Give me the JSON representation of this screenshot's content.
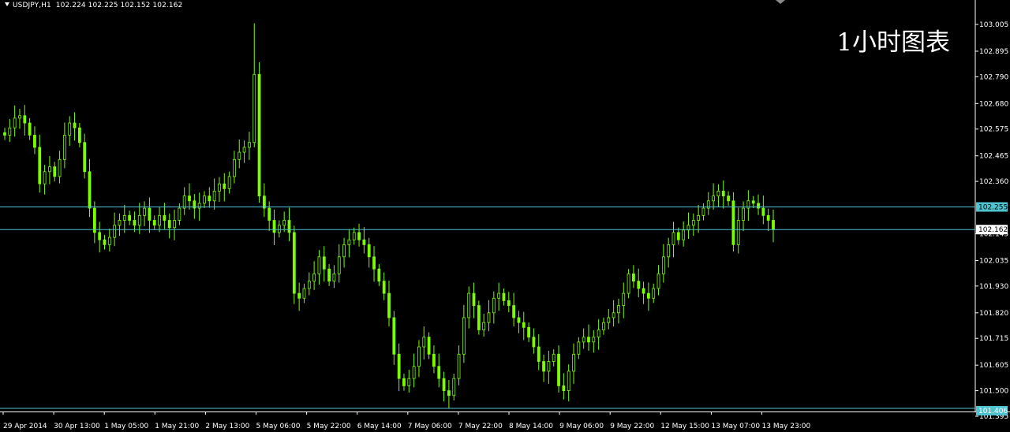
{
  "header": {
    "symbol": "USDJPY,H1",
    "prices": "102.224 102.225 102.152 102.162"
  },
  "watermark": "1小时图表",
  "colors": {
    "background": "#000000",
    "candle": "#7CFC00",
    "axis": "#ffffff",
    "hline": "#4fc3d0",
    "bid_tag_bg": "#ffffff",
    "hline_tag_bg": "#4fc3d0"
  },
  "chart_data": {
    "type": "candlestick",
    "title": "USDJPY,H1",
    "ylim": [
      101.395,
      103.11
    ],
    "y_ticks": [
      "103.005",
      "102.895",
      "102.790",
      "102.680",
      "102.575",
      "102.465",
      "102.360",
      "102.145",
      "102.035",
      "101.930",
      "101.820",
      "101.715",
      "101.605",
      "101.500",
      "101.395"
    ],
    "x_ticks": [
      "29 Apr 2014",
      "30 Apr 13:00",
      "1 May 05:00",
      "1 May 21:00",
      "2 May 13:00",
      "5 May 06:00",
      "5 May 22:00",
      "6 May 14:00",
      "7 May 06:00",
      "7 May 22:00",
      "8 May 14:00",
      "9 May 06:00",
      "9 May 22:00",
      "12 May 15:00",
      "13 May 07:00",
      "13 May 23:00"
    ],
    "hlines": [
      {
        "label": "102.255",
        "value": 102.255
      },
      {
        "label": "102.162",
        "value": 102.162
      }
    ],
    "bottom_tag": {
      "label": "101.406",
      "value": 101.406
    },
    "closes": [
      102.55,
      102.58,
      102.62,
      102.63,
      102.6,
      102.55,
      102.5,
      102.35,
      102.4,
      102.42,
      102.38,
      102.45,
      102.55,
      102.6,
      102.58,
      102.52,
      102.4,
      102.25,
      102.15,
      102.12,
      102.1,
      102.13,
      102.18,
      102.2,
      102.22,
      102.2,
      102.18,
      102.22,
      102.25,
      102.2,
      102.18,
      102.22,
      102.2,
      102.17,
      102.2,
      102.25,
      102.3,
      102.28,
      102.25,
      102.27,
      102.3,
      102.28,
      102.32,
      102.35,
      102.33,
      102.38,
      102.45,
      102.48,
      102.5,
      102.52,
      102.8,
      102.3,
      102.25,
      102.2,
      102.15,
      102.18,
      102.2,
      102.15,
      101.9,
      101.88,
      101.92,
      101.95,
      101.98,
      102.05,
      102.0,
      101.95,
      101.98,
      102.05,
      102.1,
      102.12,
      102.15,
      102.12,
      102.1,
      102.05,
      102.0,
      101.95,
      101.9,
      101.8,
      101.65,
      101.55,
      101.52,
      101.55,
      101.6,
      101.68,
      101.72,
      101.65,
      101.6,
      101.55,
      101.5,
      101.48,
      101.55,
      101.65,
      101.8,
      101.9,
      101.85,
      101.75,
      101.78,
      101.82,
      101.88,
      101.9,
      101.87,
      101.85,
      101.8,
      101.78,
      101.76,
      101.72,
      101.68,
      101.62,
      101.58,
      101.62,
      101.65,
      101.52,
      101.5,
      101.58,
      101.65,
      101.7,
      101.72,
      101.7,
      101.72,
      101.75,
      101.78,
      101.8,
      101.82,
      101.85,
      101.9,
      101.98,
      101.95,
      101.92,
      101.9,
      101.88,
      101.92,
      101.98,
      102.05,
      102.1,
      102.15,
      102.12,
      102.16,
      102.18,
      102.2,
      102.22,
      102.25,
      102.28,
      102.3,
      102.32,
      102.3,
      102.28,
      102.1,
      102.2,
      102.25,
      102.28,
      102.27,
      102.25,
      102.22,
      102.2,
      102.162
    ]
  }
}
